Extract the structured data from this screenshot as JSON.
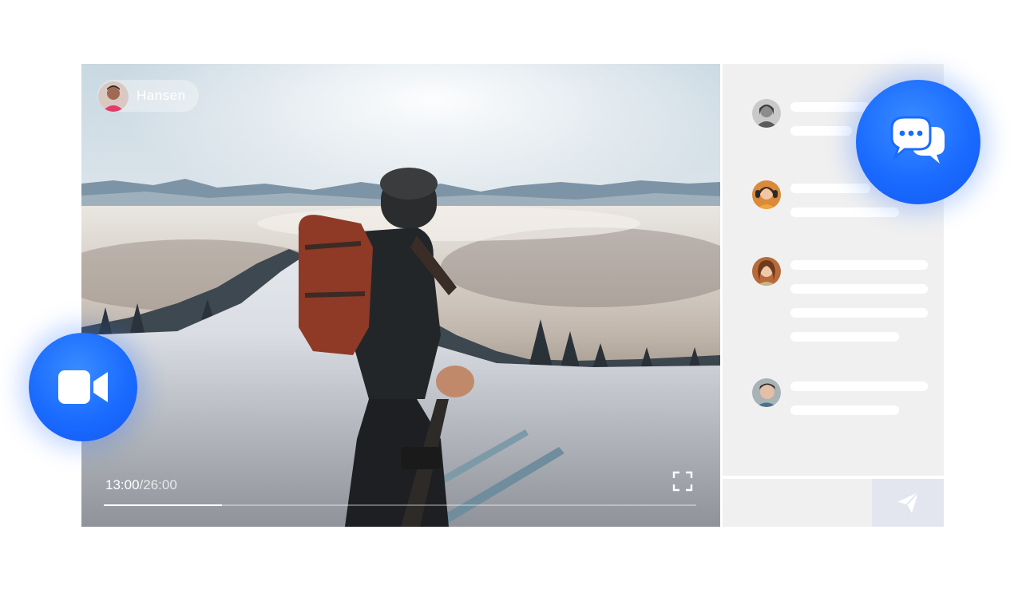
{
  "player": {
    "presenter_name": "Hansen",
    "current_time": "13:00",
    "total_time": "/26:00",
    "progress": 0.2
  },
  "chat": {
    "messages": [
      {
        "line_widths": [
          0.58,
          0.45
        ]
      },
      {
        "line_widths": [
          0.58,
          0.79
        ]
      },
      {
        "line_widths": [
          1.0,
          1.0,
          1.0,
          0.79
        ]
      },
      {
        "line_widths": [
          1.0,
          0.79
        ]
      }
    ]
  },
  "icons": {
    "chat_badge": "chat-bubbles-icon",
    "video_badge": "video-camera-icon",
    "send": "paper-plane-icon",
    "fullscreen": "fullscreen-icon"
  },
  "colors": {
    "accent": "#1a6bff",
    "chat_panel": "#f0f0f0",
    "send_button": "#e3e6ef"
  }
}
